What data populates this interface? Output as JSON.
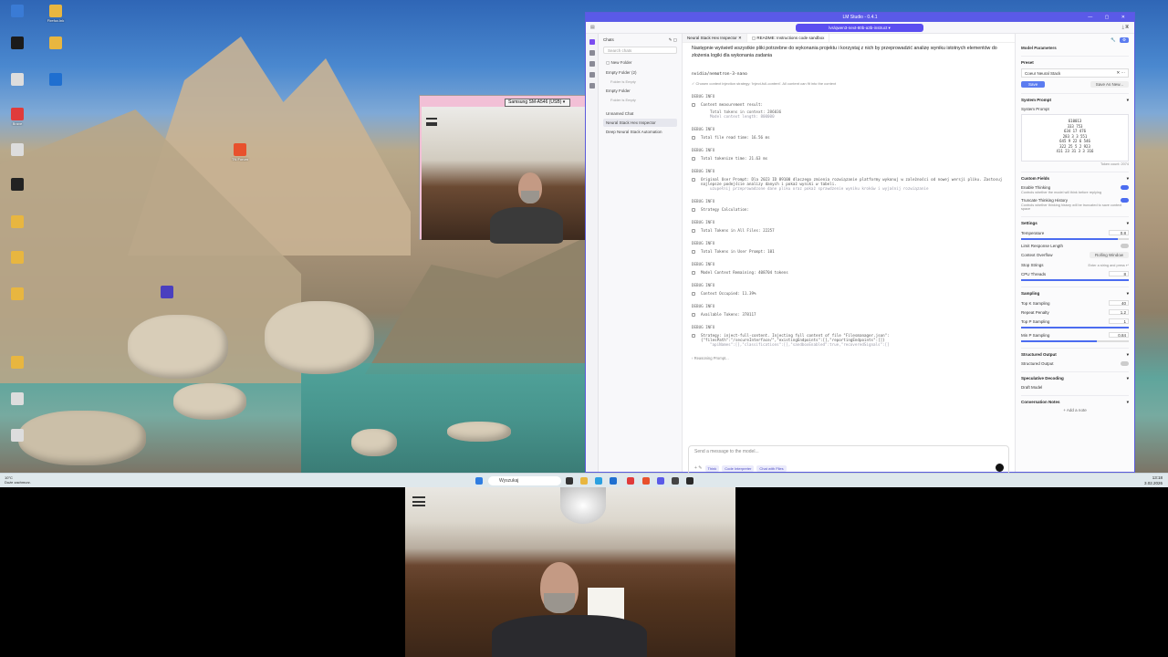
{
  "desktop": {
    "icons": [
      "",
      "Firefox.lnk",
      "",
      "",
      "",
      "",
      "Brave",
      "",
      "",
      "",
      "",
      "",
      "",
      "",
      "",
      "",
      "",
      "",
      "",
      "",
      ""
    ],
    "mid_icon": "TN Forum"
  },
  "webcam_small": {
    "device_label": "Samsung SM-A546 (USB)"
  },
  "lm": {
    "title": "LM Studio - 0.4.1",
    "model_pill": "lvs/qwen3-next-80b-a3b-instruct",
    "chats_header": "Chats",
    "search_placeholder": "Search chats",
    "new_folder": "New Folder",
    "chat_list": [
      {
        "label": "Empty Folder (2)",
        "sub": false,
        "sel": false
      },
      {
        "label": "Folder is Empty",
        "sub": true,
        "sel": false
      },
      {
        "label": "Empty Folder",
        "sub": false,
        "sel": false
      },
      {
        "label": "Folder is Empty",
        "sub": true,
        "sel": false
      },
      {
        "label": "Unnamed Chat",
        "sub": false,
        "sel": false
      },
      {
        "label": "Neural Stack Hex Inspector",
        "sub": false,
        "sel": true
      },
      {
        "label": "Deep Neural Stack Automation",
        "sub": false,
        "sel": false
      }
    ],
    "tabs": [
      "Neural Stack Hex Inspector",
      "README: Instructions code sandbox"
    ],
    "intro": "Następnie wyświetl wszystkie pliki potrzebne do wykonania projektu i korzystaj z nich by przeprowadzić analizę wyniku istotnych elementów do złożenia logiki dla wykonania zadania",
    "model_line": "nvidia/nemotron-3-nano",
    "strategy_note": "Chosen context injection strategy: 'inject-full-content'. All content can fit into the context",
    "debug": [
      {
        "tag": "DEBUG INFO",
        "text": "Content measurement result:",
        "extra": "Total tokens in context: 286036",
        "mute": "Model context length: 800000"
      },
      {
        "tag": "DEBUG INFO",
        "text": "Total file read time: 16.56 ms",
        "extra": "",
        "mute": ""
      },
      {
        "tag": "DEBUG INFO",
        "text": "Total tokenize time: 21.63 ms",
        "extra": "",
        "mute": ""
      },
      {
        "tag": "DEBUG INFO",
        "text": "Original User Prompt: Dla 2023 ID 89100 dlaczego zmienia rozwiązanie platformy wykonuj w zależności od nowej wersji pliku. Zastosuj najlepsze podejście analizy danych i pokaż wyniki w tabeli.",
        "extra": "",
        "mute": "uzupełnij przeprowadzone dane pliku oraz pokaż sprawdzenie wyniku kroków i wyjaśnij rozwiązanie"
      },
      {
        "tag": "DEBUG INFO",
        "text": "Strategy Calculation:",
        "extra": "",
        "mute": ""
      },
      {
        "tag": "DEBUG INFO",
        "text": "Total Tokens in All Files: 22257",
        "extra": "",
        "mute": ""
      },
      {
        "tag": "DEBUG INFO",
        "text": "Total Tokens in User Prompt: 101",
        "extra": "",
        "mute": ""
      },
      {
        "tag": "DEBUG INFO",
        "text": "Model Context Remaining: 408704 tokens",
        "extra": "",
        "mute": ""
      },
      {
        "tag": "DEBUG INFO",
        "text": "Context Occupied: 11.39%",
        "extra": "",
        "mute": ""
      },
      {
        "tag": "DEBUG INFO",
        "text": "Available Tokens: 378117",
        "extra": "",
        "mute": ""
      },
      {
        "tag": "DEBUG INFO",
        "text": "Strategy: inject-full-content. Injecting full content of file \"Filesmanager.json\": {\"filesPath\":\"/secureInterface/\",\"existingEndpoints\":[],\"reportingEndpoints\":[]}",
        "extra": "",
        "mute": "\"apiNames\":[],\"classifications\":[],\"sandboxEnabled\":true,\"recoveredSignals\":[]"
      }
    ],
    "reasoning": "Reasoning Prompt...",
    "input_placeholder": "Send a message to the model...",
    "input_chips": [
      "Think",
      "Code Interpreter",
      "Chat with Files"
    ]
  },
  "params": {
    "title": "Model Parameters",
    "preset_label": "Preset",
    "preset_value": "Coeur Neural Stack",
    "save": "Save",
    "save_as": "Save As New...",
    "system_prompt_header": "System Prompt",
    "system_prompt_label": "System Prompt",
    "system_prompt_lines": [
      "610013",
      "333 753",
      "634 17 476",
      "283 3 3 551",
      "645 9 22 6 546",
      "322 25 5 2 923",
      "411 23 31 3 3 316"
    ],
    "token_count": "Token count: 2074",
    "custom_fields": "Custom Fields",
    "enable_thinking": "Enable Thinking",
    "enable_thinking_desc": "Controls whether the model will think before replying",
    "truncate_history": "Truncate Thinking History",
    "truncate_history_desc": "Controls whether thinking history will be truncated to save context space",
    "settings": "Settings",
    "temperature": "Temperature",
    "temperature_val": "0.8",
    "temperature_level": 0.9,
    "limit_response": "Limit Response Length",
    "context_overflow": "Context Overflow",
    "context_overflow_val": "Rolling Window",
    "stop_strings": "Stop Strings",
    "stop_strings_ph": "Enter a string and press ↵",
    "cpu_threads": "CPU Threads",
    "cpu_threads_val": "8",
    "sampling": "Sampling",
    "top_k": "Top K Sampling",
    "top_k_val": "40",
    "repeat_penalty": "Repeat Penalty",
    "repeat_penalty_val": "1.2",
    "top_p": "Top P Sampling",
    "top_p_val": "1",
    "min_p": "Min P Sampling",
    "min_p_val": "0.84",
    "structured_output_hdr": "Structured Output",
    "structured_output": "Structured Output",
    "speculative": "Speculative Decoding",
    "draft_model": "Draft Model",
    "conv_notes": "Conversation Notes",
    "add_note": "+ Add a note"
  },
  "taskbar": {
    "search": "Wyszukaj",
    "weather": "10°C",
    "weather_sub": "Duże zachmurz.",
    "time": "13:18",
    "date": "3.02.2026"
  }
}
